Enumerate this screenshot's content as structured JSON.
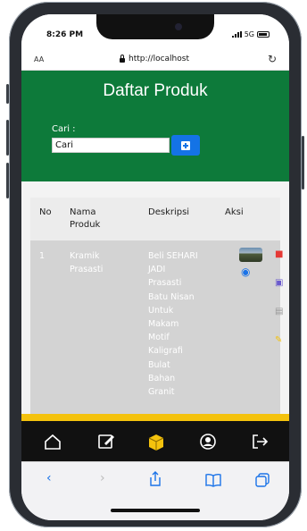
{
  "status": {
    "time": "8:26 PM",
    "network": "5G"
  },
  "browser": {
    "aa": "AA",
    "url": "http://localhost",
    "reload_icon": "reload-icon"
  },
  "page": {
    "title": "Daftar Produk",
    "search": {
      "label": "Cari :",
      "value": "Cari",
      "add_icon": "plus-square-icon"
    }
  },
  "table": {
    "headers": {
      "no": "No",
      "nama": "Nama Produk",
      "deskripsi": "Deskripsi",
      "aksi": "Aksi"
    },
    "rows": [
      {
        "no": "1",
        "nama": "Kramik Prasasti",
        "deskripsi": "Beli SEHARI JADI Prasasti Batu Nisan Untuk Makam Motif Kaligrafi Bulat Bahan Granit",
        "actions": [
          "trash-icon",
          "clipboard-check-icon",
          "print-icon",
          "edit-icon"
        ]
      }
    ]
  },
  "tabbar": [
    "home-icon",
    "edit-square-icon",
    "box-icon",
    "user-circle-icon",
    "sign-out-icon"
  ],
  "safari_toolbar": [
    "back-icon",
    "forward-icon",
    "share-icon",
    "bookmarks-icon",
    "tabs-icon"
  ],
  "colors": {
    "header": "#0d7a3a",
    "accent": "#1473e6",
    "highlight": "#f4c20d",
    "danger": "#e53935"
  }
}
